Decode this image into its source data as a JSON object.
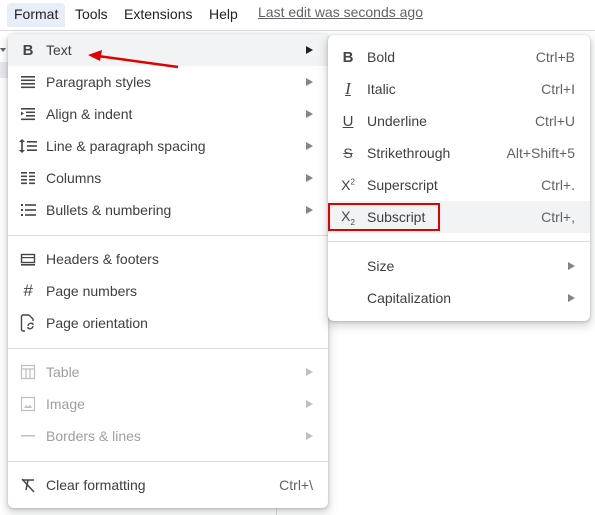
{
  "menubar": {
    "items": [
      {
        "label": "Format",
        "active": true
      },
      {
        "label": "Tools",
        "active": false
      },
      {
        "label": "Extensions",
        "active": false
      },
      {
        "label": "Help",
        "active": false
      }
    ],
    "last_edit": "Last edit was seconds ago"
  },
  "format_menu": {
    "groups": [
      [
        {
          "label": "Text",
          "icon": "bold-icon",
          "submenu": true,
          "highlighted": true
        },
        {
          "label": "Paragraph styles",
          "icon": "paragraph-styles-icon",
          "submenu": true
        },
        {
          "label": "Align & indent",
          "icon": "align-indent-icon",
          "submenu": true
        },
        {
          "label": "Line & paragraph spacing",
          "icon": "line-spacing-icon",
          "submenu": true
        },
        {
          "label": "Columns",
          "icon": "columns-icon",
          "submenu": true
        },
        {
          "label": "Bullets & numbering",
          "icon": "bullets-icon",
          "submenu": true
        }
      ],
      [
        {
          "label": "Headers & footers",
          "icon": "headers-footers-icon"
        },
        {
          "label": "Page numbers",
          "icon": "hash-icon"
        },
        {
          "label": "Page orientation",
          "icon": "page-orientation-icon"
        }
      ],
      [
        {
          "label": "Table",
          "icon": "table-icon",
          "submenu": true,
          "disabled": true
        },
        {
          "label": "Image",
          "icon": "image-icon",
          "submenu": true,
          "disabled": true
        },
        {
          "label": "Borders & lines",
          "icon": "borders-lines-icon",
          "submenu": true,
          "disabled": true
        }
      ],
      [
        {
          "label": "Clear formatting",
          "icon": "clear-formatting-icon",
          "shortcut": "Ctrl+\\"
        }
      ]
    ]
  },
  "text_submenu": {
    "items": [
      {
        "label": "Bold",
        "icon": "bold-icon",
        "shortcut": "Ctrl+B"
      },
      {
        "label": "Italic",
        "icon": "italic-icon",
        "shortcut": "Ctrl+I"
      },
      {
        "label": "Underline",
        "icon": "underline-icon",
        "shortcut": "Ctrl+U"
      },
      {
        "label": "Strikethrough",
        "icon": "strikethrough-icon",
        "shortcut": "Alt+Shift+5"
      },
      {
        "label": "Superscript",
        "icon": "superscript-icon",
        "shortcut": "Ctrl+."
      },
      {
        "label": "Subscript",
        "icon": "subscript-icon",
        "shortcut": "Ctrl+,",
        "highlighted": true
      }
    ],
    "more": [
      {
        "label": "Size",
        "submenu": true
      },
      {
        "label": "Capitalization",
        "submenu": true
      }
    ]
  },
  "annotation": {
    "color": "#e00000"
  }
}
